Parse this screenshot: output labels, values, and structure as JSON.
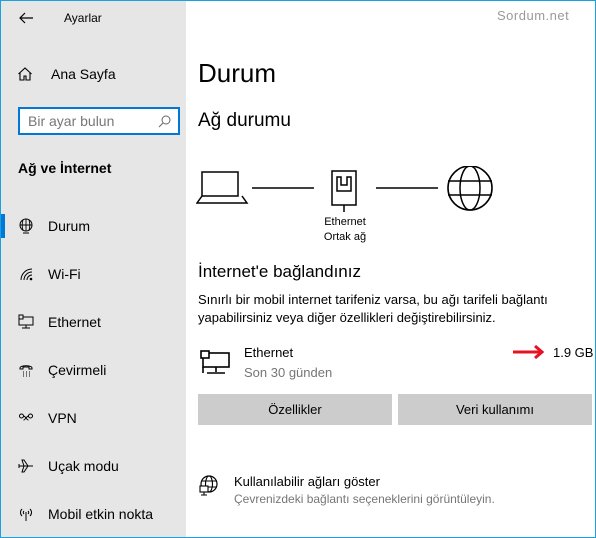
{
  "window": {
    "title": "Ayarlar",
    "watermark": "Sordum.net"
  },
  "sidebar": {
    "home_label": "Ana Sayfa",
    "search_placeholder": "Bir ayar bulun",
    "section_title": "Ağ ve İnternet",
    "items": [
      {
        "label": "Durum",
        "icon": "globe-pc-icon",
        "active": true
      },
      {
        "label": "Wi-Fi",
        "icon": "wifi-icon",
        "active": false
      },
      {
        "label": "Ethernet",
        "icon": "ethernet-icon",
        "active": false
      },
      {
        "label": "Çevirmeli",
        "icon": "dialup-phone-icon",
        "active": false
      },
      {
        "label": "VPN",
        "icon": "vpn-icon",
        "active": false
      },
      {
        "label": "Uçak modu",
        "icon": "airplane-icon",
        "active": false
      },
      {
        "label": "Mobil etkin nokta",
        "icon": "hotspot-icon",
        "active": false
      }
    ]
  },
  "main": {
    "title": "Durum",
    "subtitle": "Ağ durumu",
    "diagram": {
      "network_name": "Ethernet",
      "network_type": "Ortak ağ"
    },
    "connected_title": "İnternet'e bağlandınız",
    "connected_desc": "Sınırlı bir mobil internet tarifeniz varsa, bu ağı tarifeli bağlantı yapabilirsiniz veya diğer özellikleri değiştirebilirsiniz.",
    "connection": {
      "name": "Ethernet",
      "period": "Son 30 günden",
      "usage": "1.9 GB",
      "arrow_color": "#e81123"
    },
    "buttons": {
      "properties": "Özellikler",
      "data_usage": "Veri kullanımı"
    },
    "available": {
      "title": "Kullanılabilir ağları göster",
      "subtitle": "Çevrenizdeki bağlantı seçeneklerini görüntüleyin."
    }
  },
  "colors": {
    "accent": "#0078d7",
    "frame": "#1aa1e0",
    "sidebar_bg": "#e6e6e6",
    "button_bg": "#cccccc"
  }
}
